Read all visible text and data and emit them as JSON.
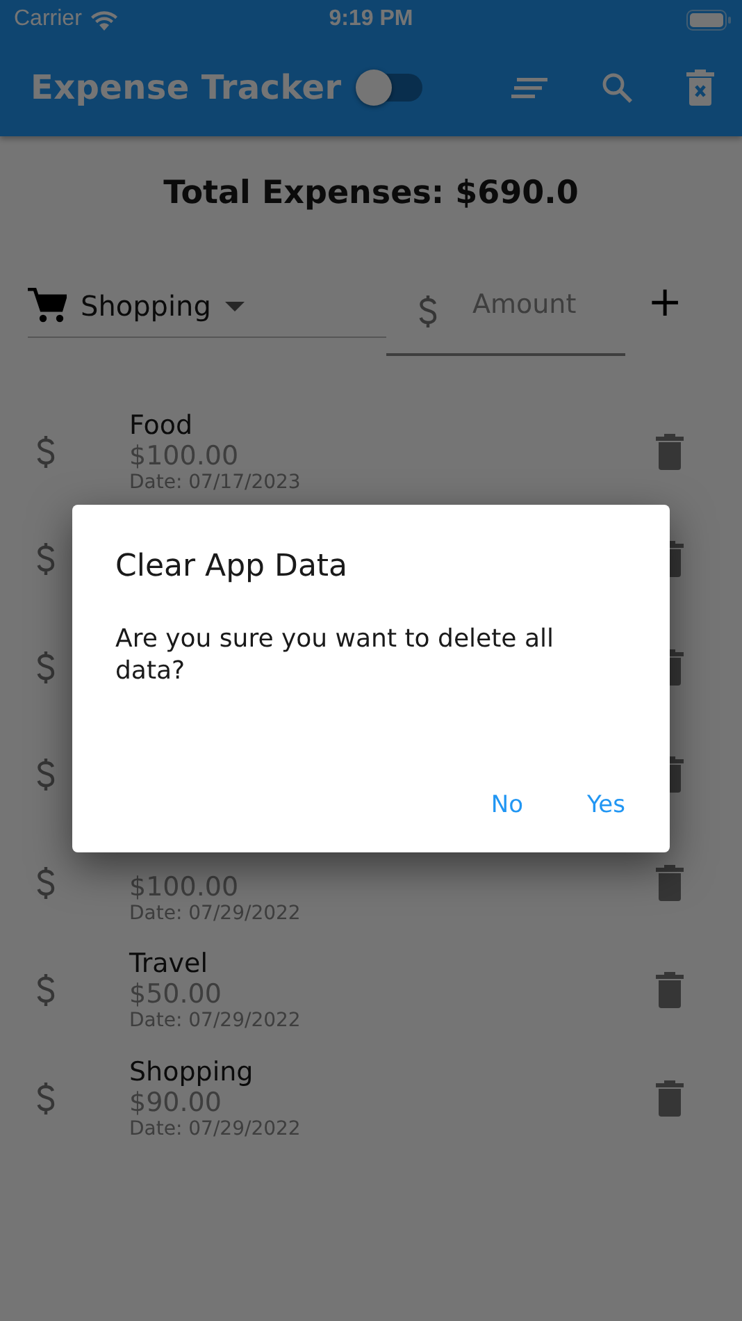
{
  "status_bar": {
    "carrier": "Carrier",
    "time": "9:19 PM"
  },
  "app_bar": {
    "title": "Expense Tracker",
    "toggle": {
      "on": false
    }
  },
  "total": "Total Expenses: $690.0",
  "form": {
    "category": "Shopping",
    "amount_placeholder": "Amount",
    "add": "+"
  },
  "expenses": [
    {
      "kind": "entry",
      "category": "Food",
      "amount": "$100.00",
      "date": "Date: 07/17/2023"
    },
    {
      "kind": "covered"
    },
    {
      "kind": "covered"
    },
    {
      "kind": "covered"
    },
    {
      "kind": "top_covered",
      "amount": "$100.00",
      "date": "Date: 07/29/2022"
    },
    {
      "kind": "entry",
      "category": "Travel",
      "amount": "$50.00",
      "date": "Date: 07/29/2022"
    },
    {
      "kind": "entry",
      "category": "Shopping",
      "amount": "$90.00",
      "date": "Date: 07/29/2022"
    }
  ],
  "dialog": {
    "title": "Clear App Data",
    "message": "Are you sure you want to delete all data?",
    "buttons": [
      "No",
      "Yes"
    ]
  }
}
